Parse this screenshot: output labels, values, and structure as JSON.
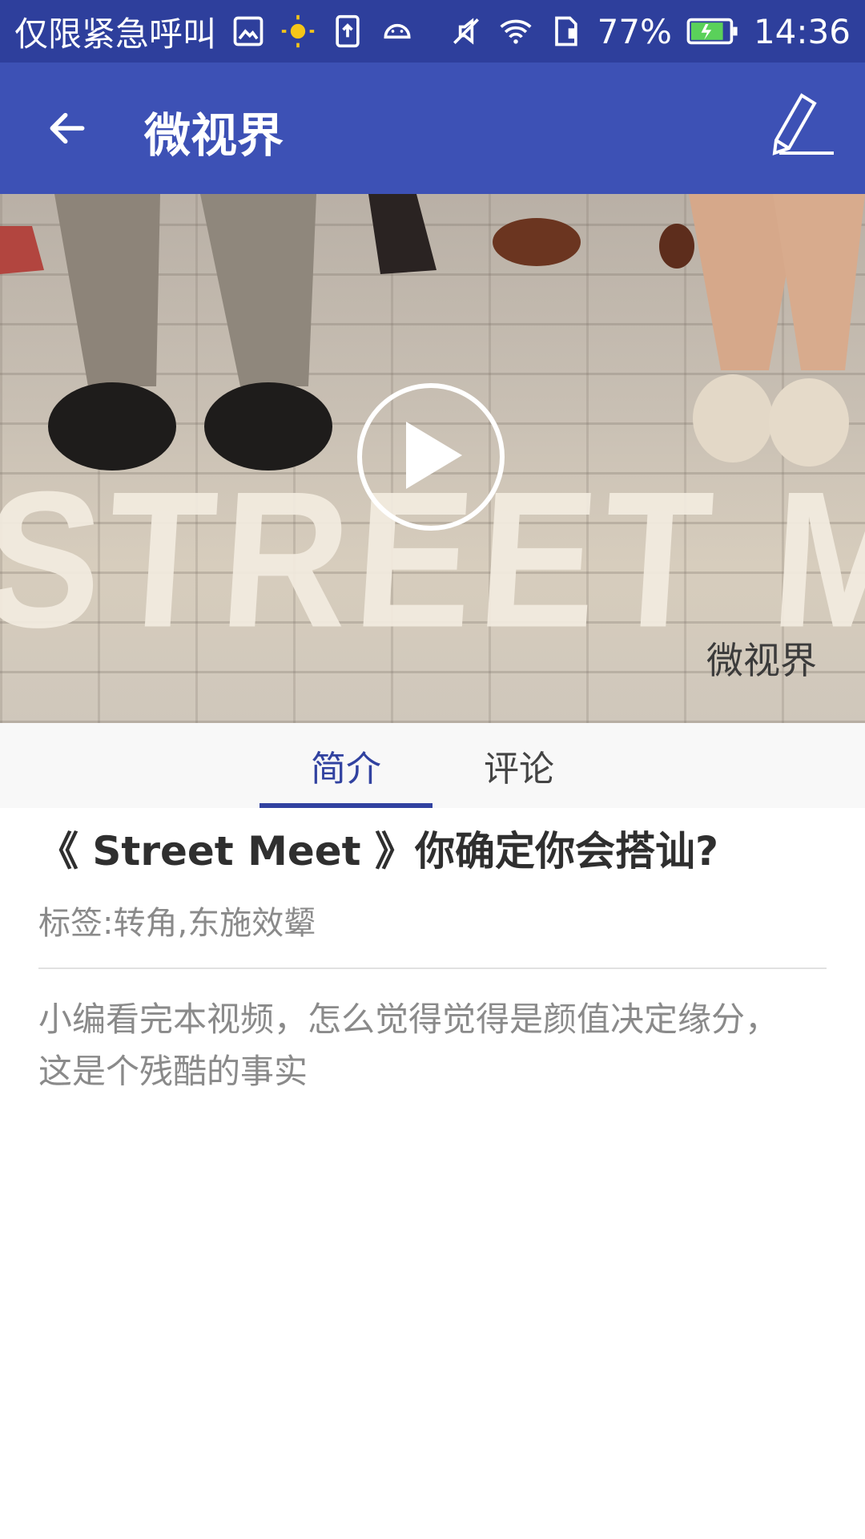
{
  "status_bar": {
    "carrier": "仅限紧急呼叫",
    "battery": "77%",
    "time": "14:36",
    "icons_left": [
      "gallery-icon",
      "sun-icon",
      "upload-icon",
      "android-icon"
    ],
    "icons_right": [
      "mute-icon",
      "wifi-icon",
      "sim-icon",
      "battery-icon"
    ]
  },
  "appbar": {
    "title": "微视界",
    "back_icon": "arrow-left-icon",
    "edit_icon": "pencil-icon"
  },
  "video": {
    "watermark": "微视界",
    "play_icon": "play-icon",
    "scene_text": "STREET MEET"
  },
  "tabs": [
    {
      "label": "简介",
      "active": true
    },
    {
      "label": "评论",
      "active": false
    }
  ],
  "article": {
    "title": "《 Street Meet 》你确定你会搭讪?",
    "tags_label": "标签:",
    "tags_value": "转角,东施效颦",
    "description": "小编看完本视频，怎么觉得觉得是颜值决定缘分，这是个残酷的事实"
  },
  "colors": {
    "status_bar": "#2e3f9c",
    "app_bar": "#3d51b5",
    "tab_active": "#3142a0"
  }
}
